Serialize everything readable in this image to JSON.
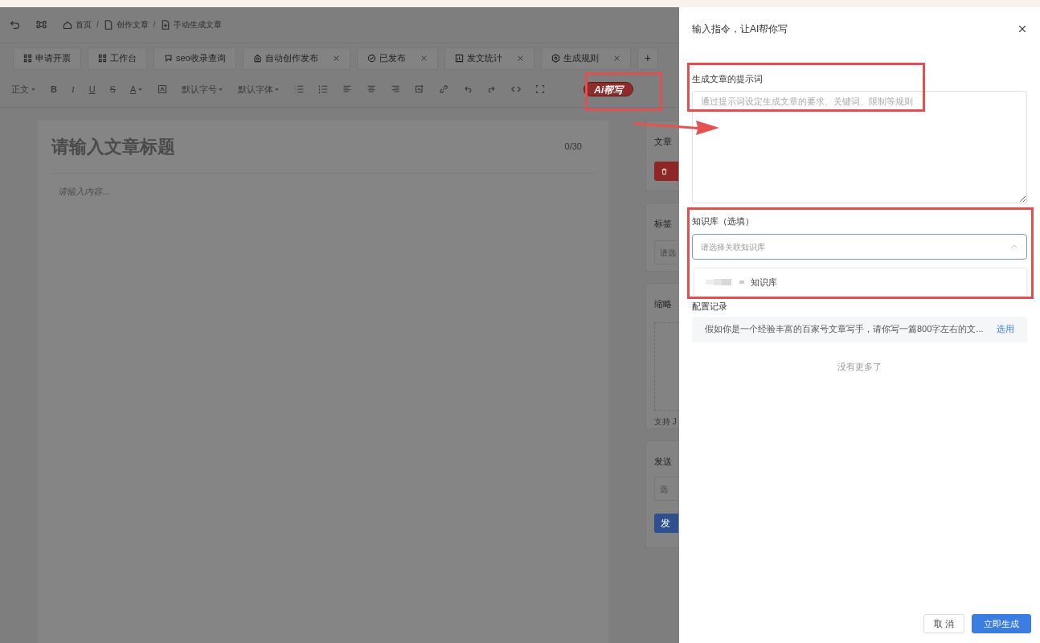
{
  "breadcrumb": [
    {
      "label": "首页"
    },
    {
      "label": "创作文章"
    },
    {
      "label": "手动生成文章"
    }
  ],
  "breadcrumb_separator": "/",
  "tabs": [
    {
      "label": "申请开票",
      "closable": false
    },
    {
      "label": "工作台",
      "closable": false
    },
    {
      "label": "seo收录查询",
      "closable": false
    },
    {
      "label": "自动创作发布",
      "closable": true
    },
    {
      "label": "已发布",
      "closable": true
    },
    {
      "label": "发文统计",
      "closable": true
    },
    {
      "label": "生成规则",
      "closable": true
    }
  ],
  "add_tab": "+",
  "toolbar": {
    "paragraph": "正文",
    "bold": "B",
    "italic": "I",
    "underline": "U",
    "strike": "S",
    "font_color": "A",
    "font_size": "默认字号",
    "font_family": "默认字体",
    "ai_button": "Ai帮写"
  },
  "editor": {
    "title_placeholder": "请输入文章标题",
    "title_count": "0/30",
    "content_placeholder": "请输入内容..."
  },
  "side_cards": [
    {
      "title": "文章",
      "kind": "delete"
    },
    {
      "title": "标签",
      "kind": "select",
      "placeholder": "请选"
    },
    {
      "title": "缩略",
      "kind": "upload",
      "hint": "支持 J"
    },
    {
      "title": "发送",
      "kind": "select-submit",
      "placeholder": "选",
      "button": "发"
    }
  ],
  "drawer": {
    "title": "输入指令，让AI帮你写",
    "prompt_label": "生成文章的提示词",
    "prompt_placeholder": "通过提示词设定生成文章的要求、关键词、限制等规则",
    "knowledge_label": "知识库（选填）",
    "knowledge_placeholder": "请选择关联知识库",
    "knowledge_expanded": true,
    "knowledge_options": [
      {
        "label": "知识库"
      }
    ],
    "records_label": "配置记录",
    "records": [
      {
        "text": "假如你是一个经验丰富的百家号文章写手，请你写一篇800字左右的文...",
        "action": "选用"
      }
    ],
    "no_more": "没有更多了",
    "buttons": [
      {
        "label": "取 消",
        "kind": "secondary"
      },
      {
        "label": "立即生成",
        "kind": "primary"
      }
    ]
  }
}
